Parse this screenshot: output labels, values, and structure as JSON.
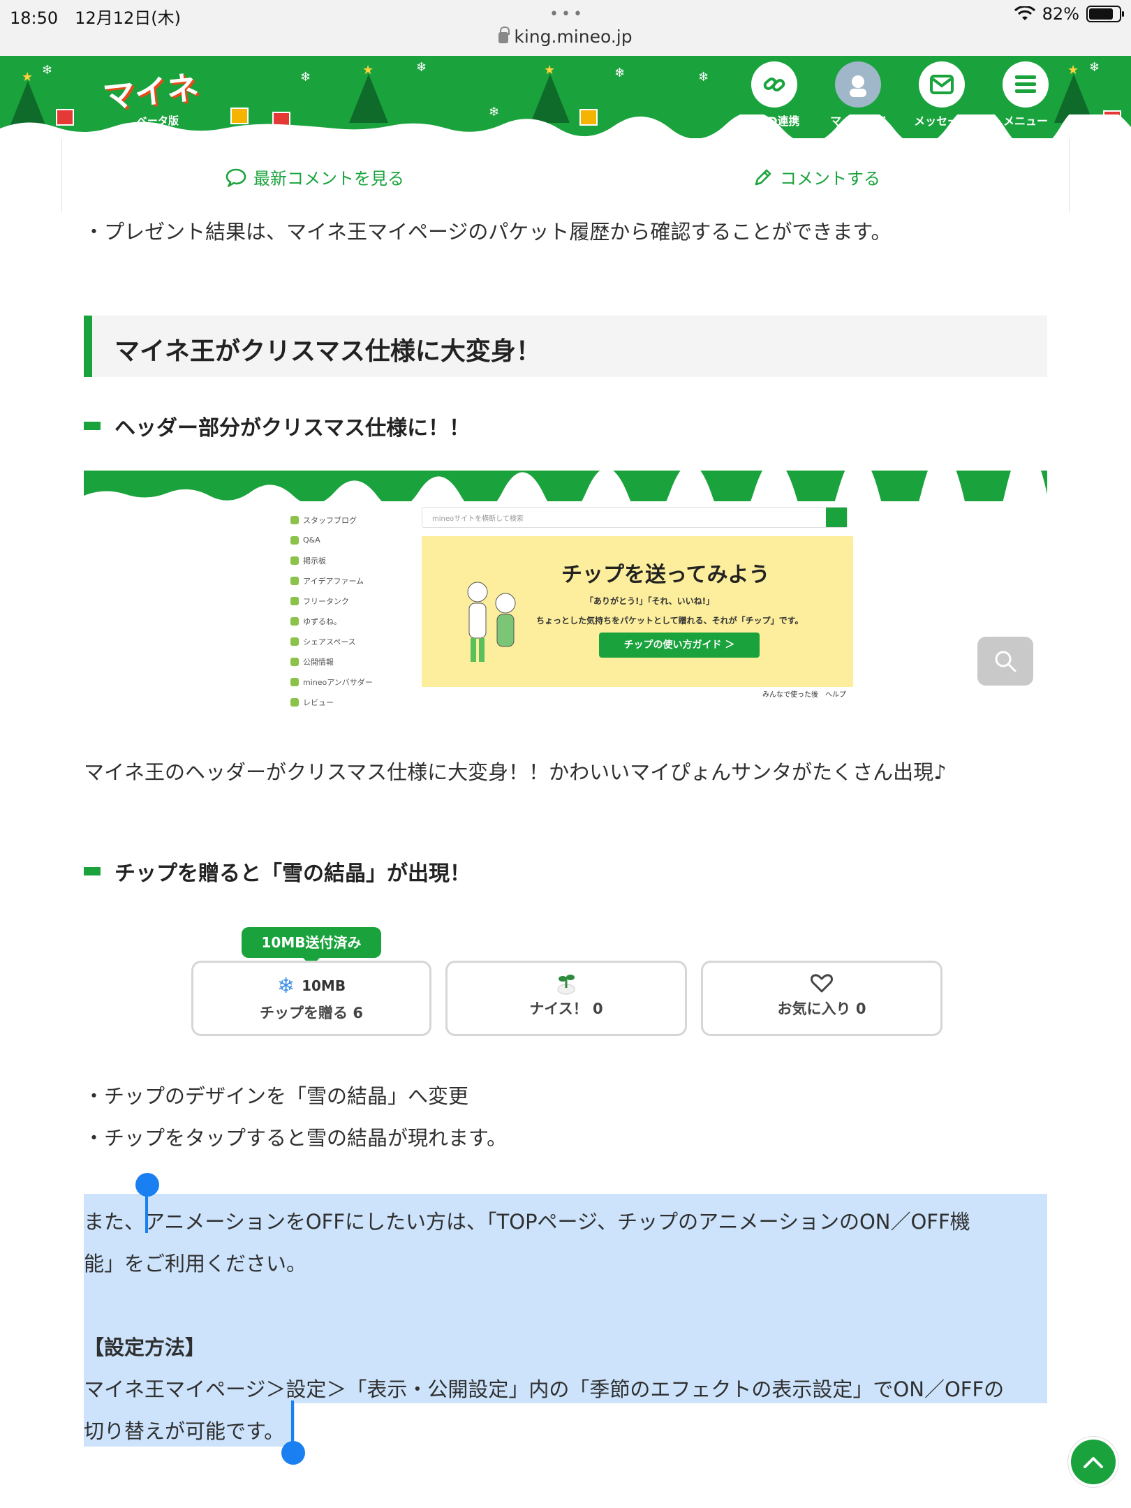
{
  "status": {
    "time": "18:50",
    "date": "12月12日(木)",
    "battery": "82%",
    "url": "king.mineo.jp",
    "dots": "•••"
  },
  "header": {
    "logo": "マイネ王",
    "beta": "ベータ版",
    "nav": [
      {
        "label": "eoID連携",
        "icon": "link-icon"
      },
      {
        "label": "マイページ",
        "icon": "avatar-icon"
      },
      {
        "label": "メッセージ",
        "icon": "mail-icon"
      },
      {
        "label": "メニュー",
        "icon": "menu-icon"
      }
    ]
  },
  "comment_bar": {
    "latest": "最新コメントを見る",
    "write": "コメントする"
  },
  "article": {
    "present_note": "・プレゼント結果は、マイネ王マイページのパケット履歴から確認することができます。",
    "h2": "マイネ王がクリスマス仕様に大変身！",
    "h3_header": "ヘッダー部分がクリスマス仕様に！！",
    "figure": {
      "sidebar": [
        "スタッフブログ",
        "Q&A",
        "掲示板",
        "アイデアファーム",
        "フリータンク",
        "ゆずるね。",
        "シェアスペース",
        "公開情報",
        "mineoアンバサダー",
        "レビュー"
      ],
      "search_placeholder": "mineoサイトを横断して検索",
      "banner_title": "チップを送ってみよう",
      "banner_sub1": "「ありがとう!」「それ、いいね!」",
      "banner_sub2": "ちょっとした気持ちをパケットとして贈れる、それが「チップ」です。",
      "banner_button": "チップの使い方ガイド ＞",
      "footer": "みんなで使った後　ヘルプ"
    },
    "header_desc": "マイネ王のヘッダーがクリスマス仕様に大変身！！かわいいマイぴょんサンタがたくさん出現♪",
    "h3_tip": "チップを贈ると「雪の結晶」が出現！",
    "tip_demo": {
      "badge": "10MB送付済み",
      "tip_amount": "10MB",
      "tip_label": "チップを贈る 6",
      "nice_label": "ナイス！ 0",
      "fav_label": "お気に入り 0"
    },
    "tip_bullet1": "・チップのデザインを「雪の結晶」へ変更",
    "tip_bullet2": "・チップをタップすると雪の結晶が現れます。",
    "anim_line1": "また、アニメーションをOFFにしたい方は、「TOPページ、チップのアニメーションのON／OFF機",
    "anim_line2": "能」をご利用ください。",
    "setting_head": "【設定方法】",
    "setting_line1": "マイネ王マイページ＞設定＞「表示・公開設定」内の「季節のエフェクトの表示設定」でON／OFFの",
    "setting_line2": "切り替えが可能です。"
  },
  "colors": {
    "brand": "#1aa33c",
    "selection": "#cce3fb",
    "handle": "#1a7ff0"
  }
}
